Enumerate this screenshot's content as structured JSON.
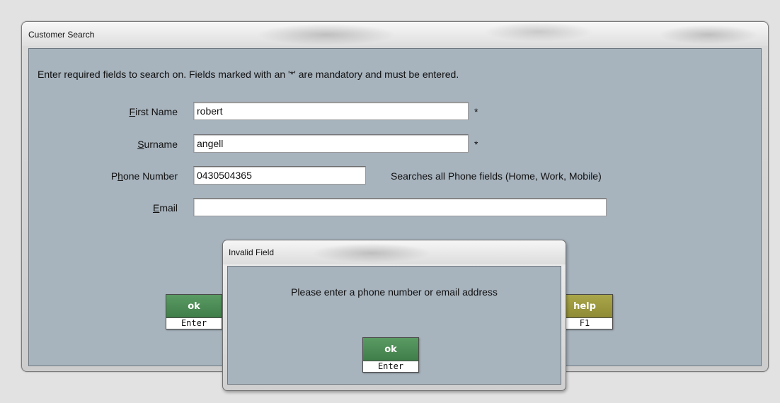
{
  "window": {
    "title": "Customer Search",
    "instructions": "Enter required fields to search on.  Fields marked with an '*' are mandatory and must be entered."
  },
  "form": {
    "first_name": {
      "label": "First Name",
      "accel": "F",
      "rest": "irst Name",
      "value": "robert",
      "required_mark": "*"
    },
    "surname": {
      "label": "Surname",
      "accel": "S",
      "rest": "urname",
      "value": "angell",
      "required_mark": "*"
    },
    "phone": {
      "label": "Phone Number",
      "pre": "P",
      "accel": "h",
      "rest": "one Number",
      "value": "0430504365",
      "hint": "Searches all Phone fields (Home, Work, Mobile)"
    },
    "email": {
      "label": "Email",
      "accel": "E",
      "rest": "mail",
      "value": ""
    }
  },
  "buttons": {
    "ok": {
      "label": "ok",
      "key": "Enter",
      "color": "#4a8a53"
    },
    "help": {
      "label": "help",
      "key": "F1",
      "color": "#9b9840"
    }
  },
  "dialog": {
    "title": "Invalid Field",
    "message": "Please enter a phone number or email address",
    "ok": {
      "label": "ok",
      "key": "Enter"
    }
  },
  "colors": {
    "panel": "#a7b3bd",
    "green_button": "#4a8a53",
    "olive_button": "#9b9840"
  }
}
